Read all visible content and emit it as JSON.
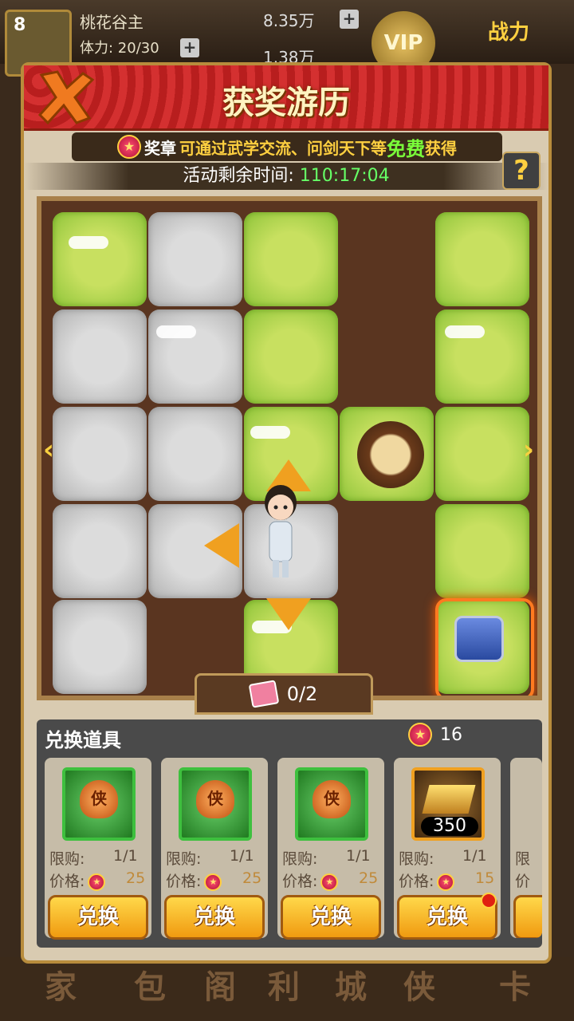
{
  "topbar": {
    "level": "8",
    "player_name": "桃花谷主",
    "stamina": "体力: 20/30",
    "silver": "8.35万",
    "gold": "1.38万",
    "vip": "VIP",
    "power_label": "战力"
  },
  "background_tabs": [
    "家",
    "包",
    "阁",
    "利",
    "城",
    "侠",
    "卡"
  ],
  "panel": {
    "title": "获奖游历",
    "medal_label": "奖章",
    "medal_desc": "可通过武学交流、问剑天下等",
    "medal_free": "免费",
    "medal_get": "获得",
    "timer_label": "活动剩余时间:",
    "timer_value": "110:17:04",
    "help": "?"
  },
  "board": {
    "progress": "0/2"
  },
  "shop": {
    "title": "兑换道具",
    "medal_count": "16",
    "items": [
      {
        "icon": "侠",
        "limit_label": "限购:",
        "limit": "1/1",
        "price_label": "价格:",
        "price": "25",
        "button": "兑换"
      },
      {
        "icon": "侠",
        "limit_label": "限购:",
        "limit": "1/1",
        "price_label": "价格:",
        "price": "25",
        "button": "兑换"
      },
      {
        "icon": "侠",
        "limit_label": "限购:",
        "limit": "1/1",
        "price_label": "价格:",
        "price": "25",
        "button": "兑换"
      },
      {
        "quantity": "350",
        "limit_label": "限购:",
        "limit": "1/1",
        "price_label": "价格:",
        "price": "15",
        "button": "兑换"
      },
      {
        "limit_label": "限",
        "price_label": "价"
      }
    ]
  }
}
